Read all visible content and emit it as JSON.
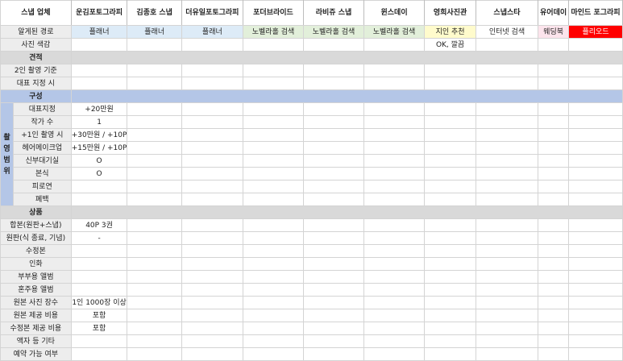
{
  "header": {
    "corner": "스냅 업체",
    "vendors": [
      "운김포토그라피",
      "김종호 스냅",
      "더유일포토그라피",
      "포더브라이드",
      "라비쥬 스냅",
      "윈스데이",
      "영희사진관",
      "스냅스타",
      "유어데이",
      "마인드 포그라피"
    ]
  },
  "rows": {
    "source": {
      "label": "알게된 경로",
      "values": [
        "플래너",
        "플래너",
        "플래너",
        "노벨라홀 검색",
        "노벨라홀 검색",
        "노벨라홀 검색",
        "지인 추천",
        "인터넷 검색",
        "웨딩북",
        "플리오드"
      ]
    },
    "color": {
      "label": "사진 색감",
      "values": [
        "",
        "",
        "",
        "",
        "",
        "",
        "OK, 깔끔",
        "",
        "",
        ""
      ]
    }
  },
  "section_estimate": {
    "title": "견적",
    "rows": [
      {
        "label": "2인 촬영 기준"
      },
      {
        "label": "대표 지정 시"
      }
    ]
  },
  "section_composition": {
    "title": "구성",
    "side_label": "촬영범위",
    "rows": [
      {
        "label": "대표지정",
        "value": "+20만원"
      },
      {
        "label": "작가 수",
        "value": "1"
      },
      {
        "label": "+1인 촬영 시",
        "value": "+30만원 / +10P"
      },
      {
        "label": "헤어메이크업",
        "value": "+15만원 / +10P"
      },
      {
        "label": "신부대기실",
        "value": "O"
      },
      {
        "label": "본식",
        "value": "O"
      },
      {
        "label": "피로연",
        "value": ""
      },
      {
        "label": "폐백",
        "value": ""
      }
    ]
  },
  "section_product": {
    "title": "상품",
    "rows": [
      {
        "label": "합본(원판+스냅)",
        "value": "40P 3권"
      },
      {
        "label": "원판(식 종료, 기념)",
        "value": "-"
      },
      {
        "label": "수정본",
        "value": ""
      },
      {
        "label": "인화",
        "value": ""
      },
      {
        "label": "부부용 앨범",
        "value": ""
      },
      {
        "label": "혼주용 앨범",
        "value": ""
      },
      {
        "label": "원본 사진 장수",
        "value": "1인 1000장 이상"
      },
      {
        "label": "원본 제공 비용",
        "value": "포함"
      },
      {
        "label": "수정본 제공 비용",
        "value": "포함"
      },
      {
        "label": "액자 등 기타",
        "value": ""
      }
    ]
  },
  "footer": {
    "label": "예약 가능 여부"
  },
  "colors": {
    "accent_blue": "#b4c6e7",
    "accent_red": "#ff0000",
    "accent_yellow": "#fffbcc"
  }
}
